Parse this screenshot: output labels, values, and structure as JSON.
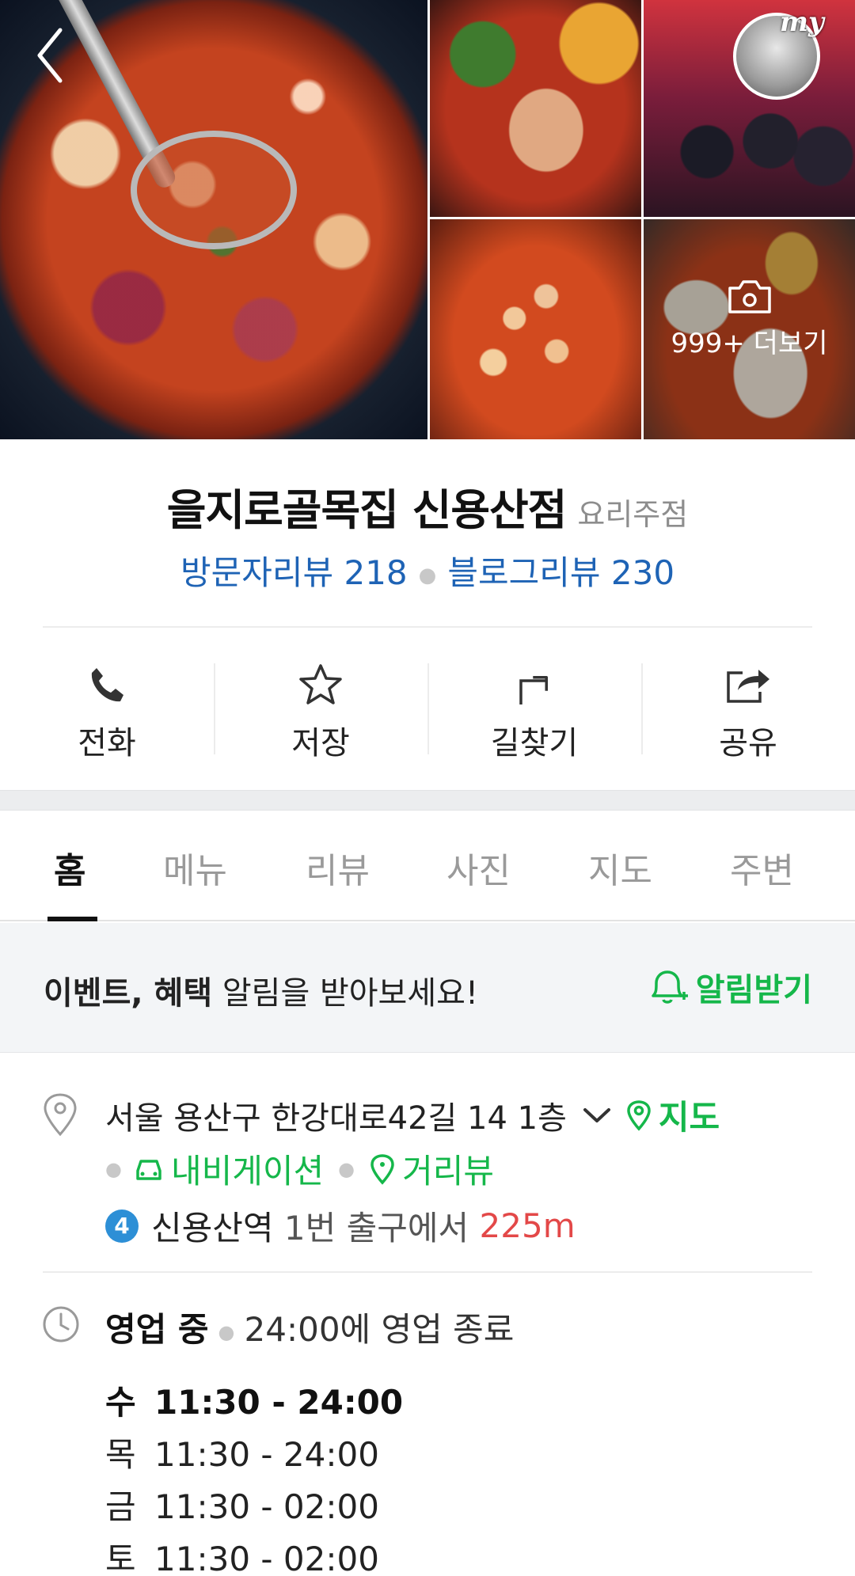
{
  "gallery": {
    "more_label": "999+ 더보기",
    "avatar_badge": "my"
  },
  "place": {
    "name": "을지로골목집 신용산점",
    "category": "요리주점",
    "visitor_reviews": "방문자리뷰 218",
    "blog_reviews": "블로그리뷰 230"
  },
  "actions": [
    {
      "label": "전화",
      "icon": "phone-icon"
    },
    {
      "label": "저장",
      "icon": "star-icon"
    },
    {
      "label": "길찾기",
      "icon": "directions-icon"
    },
    {
      "label": "공유",
      "icon": "share-icon"
    }
  ],
  "tabs": [
    "홈",
    "메뉴",
    "리뷰",
    "사진",
    "지도",
    "주변"
  ],
  "active_tab": "홈",
  "notice": {
    "bold": "이벤트, 혜택",
    "text": " 알림을 받아보세요!",
    "button": "알림받기"
  },
  "address": {
    "text": "서울 용산구 한강대로42길 14 1층",
    "map_label": "지도",
    "navigation_label": "내비게이션",
    "streetview_label": "거리뷰",
    "subway_line": "4",
    "station": "신용산역",
    "exit_text": " 1번 출구에서 ",
    "distance": "225m"
  },
  "hours": {
    "status": "영업 중",
    "closing": "24:00에 영업 종료",
    "schedule": [
      {
        "day": "수",
        "time": "11:30 - 24:00"
      },
      {
        "day": "목",
        "time": "11:30 - 24:00"
      },
      {
        "day": "금",
        "time": "11:30 - 02:00"
      },
      {
        "day": "토",
        "time": "11:30 - 02:00"
      }
    ]
  },
  "colors": {
    "accent_green": "#15b74a",
    "link_blue": "#1e63b5",
    "distance_red": "#e34848",
    "subway_line4": "#2d8fd6"
  }
}
